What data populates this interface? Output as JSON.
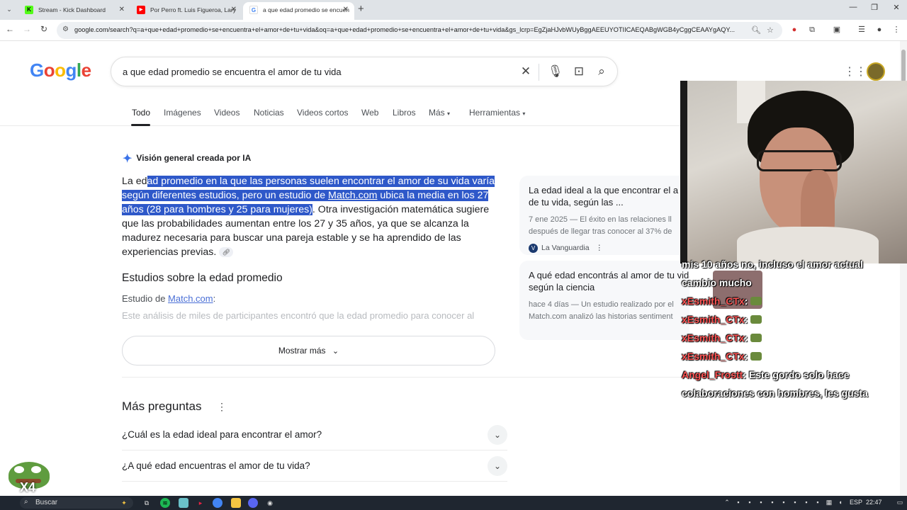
{
  "browser": {
    "tabs": [
      {
        "title": "Stream - Kick Dashboard",
        "favicon": "kick-icon",
        "color": "#53fc18"
      },
      {
        "title": "Por Perro ft. Luis Figueroa, Lary",
        "favicon": "youtube-icon",
        "color": "#ff0000"
      },
      {
        "title": "a que edad promedio se encuen",
        "favicon": "google-icon",
        "color": "#4285f4"
      }
    ],
    "url": "google.com/search?q=a+que+edad+promedio+se+encuentra+el+amor+de+tu+vida&oq=a+que+edad+promedio+se+encuentra+el+amor+de+tu+vida&gs_lcrp=EgZjaHJvbWUyBggAEEUYOTIICAEQABgWGB4yCggCEAAYgAQY..."
  },
  "google": {
    "logo": "Google",
    "logo_colors": [
      "#4285f4",
      "#ea4335",
      "#fbbc05",
      "#4285f4",
      "#34a853",
      "#ea4335"
    ],
    "query": "a que edad promedio se encuentra el amor de tu vida",
    "tabs": [
      "Todo",
      "Imágenes",
      "Videos",
      "Noticias",
      "Videos cortos",
      "Web",
      "Libros",
      "Más",
      "Herramientas"
    ]
  },
  "ai_overview": {
    "heading": "Visión general creada por IA",
    "p1_a": "La ed",
    "p1_hl1": "ad promedio en la que las personas suelen encontrar el amor de su vida varía según diferentes estudios, pero un estudio de ",
    "p1_link": "Match.com",
    "p1_hl2": " ubica la media en los 27 años (28 para hombres y 25 para mujeres)",
    "p1_b": ". Otra investigación matemática sugiere que las probabilidades aumentan entre los 27 y 35 años, ya que se alcanza la madurez necesaria para buscar una pareja estable y se ha aprendido de las experiencias previas.",
    "subheading": "Estudios sobre la edad promedio",
    "study_prefix": "Estudio de ",
    "study_link": "Match.com",
    "study_suffix": ":",
    "faded_line": "Este análisis de miles de participantes encontró que la edad promedio para conocer al",
    "show_more": "Mostrar más"
  },
  "sources": [
    {
      "title1": "La edad ideal a la que encontrar el a",
      "title2": "de tu vida, según las ...",
      "snip1": "7 ene 2025 — El éxito en las relaciones ll",
      "snip2": "después de llegar tras conocer al 37% de",
      "source": "La Vanguardia",
      "badge": "V"
    },
    {
      "title1": "A qué edad encontrás al amor de tu vida",
      "title2": "según la ciencia",
      "snip1": "hace 4 días — Un estudio realizado por el",
      "snip2": "Match.com analizó las historias sentiment"
    }
  ],
  "people_ask": {
    "heading": "Más preguntas",
    "questions": [
      "¿Cuál es la edad ideal para encontrar el amor?",
      "¿A qué edad encuentras el amor de tu vida?"
    ]
  },
  "stream_chat": {
    "lines": [
      {
        "user": "",
        "text": "mis 10 años no, incluso el amor actual"
      },
      {
        "user": "",
        "text": "cambio mucho"
      },
      {
        "user": "xEsmith_CTx",
        "text": ":"
      },
      {
        "user": "xEsmith_CTx",
        "text": ":"
      },
      {
        "user": "xEsmith_CTx",
        "text": ":"
      },
      {
        "user": "xEsmith_CTx",
        "text": ":"
      },
      {
        "user": "Angel_Frostt",
        "text": ": Este gordo solo hace"
      },
      {
        "user": "",
        "text": "colaboraciones con hombres, les gusta"
      }
    ]
  },
  "sticker": {
    "label": "X4"
  },
  "taskbar": {
    "search": "Buscar",
    "lang": "ESP",
    "time": "22:47"
  }
}
